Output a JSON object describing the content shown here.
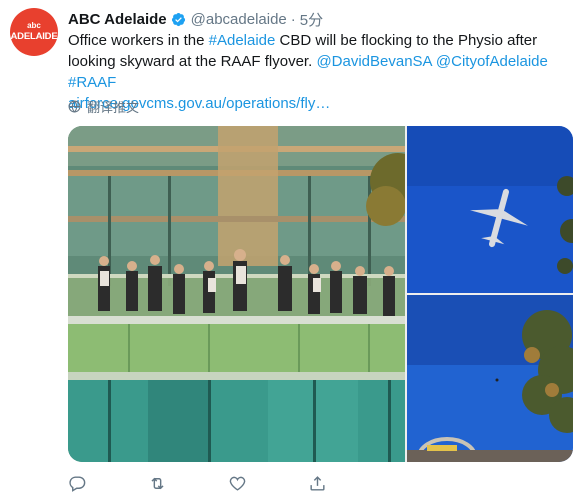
{
  "account": {
    "avatar_mark": "abc",
    "avatar_text": "ADELAIDE",
    "name": "ABC Adelaide",
    "handle": "@abcadelaide",
    "separator": "·",
    "time": "5分"
  },
  "tweet": {
    "line1_pre": "Office workers in the ",
    "hashtag_adelaide": "#Adelaide",
    "line1_post": " CBD will be flocking to the Physio after looking skyward at the RAAF flyover. ",
    "mention_1": "@DavidBevanSA",
    "mention_2": "@CityofAdelaide",
    "hashtag_raaf": "#RAAF",
    "url": "airforce.govcms.gov.au/operations/fly…"
  },
  "translate": {
    "label": "翻译推文",
    "icon": "globe-icon"
  },
  "media": [
    {
      "name": "office-workers-balcony-photo"
    },
    {
      "name": "plane-overhead-photo"
    },
    {
      "name": "trees-sky-photo"
    }
  ],
  "actions": [
    {
      "name": "reply-button",
      "icon": "reply-icon"
    },
    {
      "name": "retweet-button",
      "icon": "retweet-icon"
    },
    {
      "name": "like-button",
      "icon": "heart-icon"
    },
    {
      "name": "share-button",
      "icon": "share-icon"
    }
  ],
  "colors": {
    "link": "#1b95e0",
    "avatar": "#e8402e",
    "muted": "#657786",
    "text": "#14171a"
  }
}
